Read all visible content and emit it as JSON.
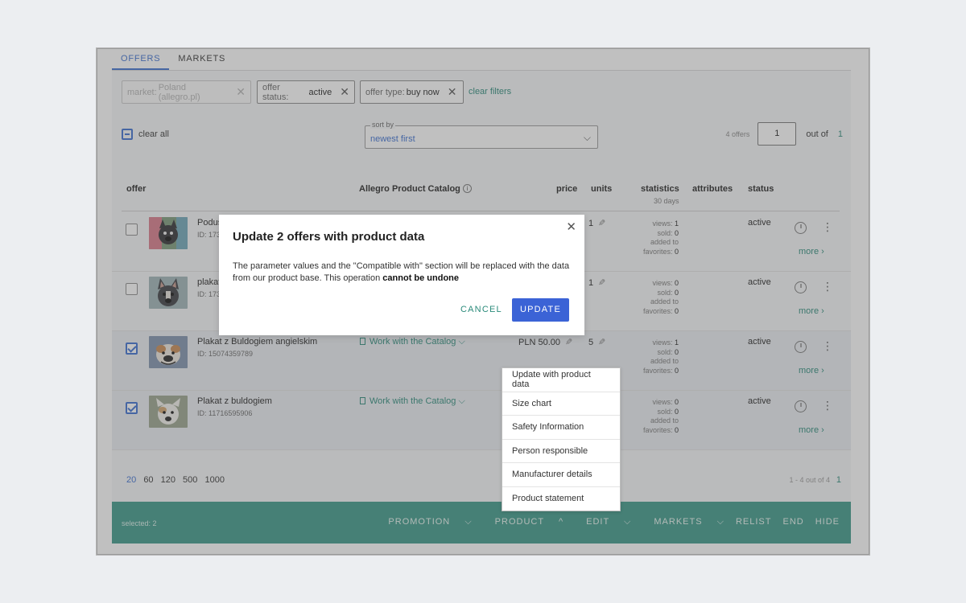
{
  "tabs": [
    "OFFERS",
    "MARKETS"
  ],
  "filters": [
    {
      "key": "market:",
      "value": "Poland (allegro.pl)",
      "disabled": true
    },
    {
      "key": "offer status:",
      "value": "active",
      "disabled": false
    },
    {
      "key": "offer type:",
      "value": "buy now",
      "disabled": false
    }
  ],
  "clear_filters": "clear filters",
  "clear_all": "clear all",
  "sort": {
    "label": "sort by",
    "value": "newest first"
  },
  "pagination_top": {
    "count": "4 offers",
    "page": "1",
    "out_of": "out of",
    "total": "1"
  },
  "columns": {
    "offer": "offer",
    "catalog": "Allegro Product Catalog",
    "price": "price",
    "units": "units",
    "statistics": "statistics",
    "statistics_sub": "30 days",
    "attributes": "attributes",
    "status": "status"
  },
  "rows": [
    {
      "title": "Podus",
      "id": "ID: 173",
      "catalog": "",
      "price": "",
      "units": "1",
      "views": "1",
      "sold": "0",
      "favorites": "0",
      "status": "active",
      "checked": false,
      "more": "more"
    },
    {
      "title": "plakat",
      "id": "ID: 173",
      "catalog": "",
      "price": "",
      "units": "1",
      "views": "0",
      "sold": "0",
      "favorites": "0",
      "status": "active",
      "checked": false,
      "more": "more"
    },
    {
      "title": "Plakat z Buldogiem angielskim",
      "id": "ID: 15074359789",
      "catalog": "Work with the Catalog",
      "price": "PLN 50.00",
      "units": "5",
      "views": "1",
      "sold": "0",
      "favorites": "0",
      "status": "active",
      "checked": true,
      "more": "more"
    },
    {
      "title": "Plakat z buldogiem",
      "id": "ID: 11716595906",
      "catalog": "Work with the Catalog",
      "price": "",
      "units": "",
      "views": "0",
      "sold": "0",
      "favorites": "0",
      "status": "active",
      "checked": true,
      "more": "more"
    }
  ],
  "stat_labels": {
    "views": "views:",
    "sold": "sold:",
    "added_to": "added to",
    "favorites": "favorites:"
  },
  "page_sizes": [
    "20",
    "60",
    "120",
    "500",
    "1000"
  ],
  "range": "1 - 4 out of 4",
  "range_page": "1",
  "bottom_bar": {
    "selected": "selected: 2",
    "actions": [
      "PROMOTION",
      "PRODUCT",
      "EDIT",
      "MARKETS",
      "RELIST",
      "END",
      "HIDE"
    ]
  },
  "product_menu": [
    "Update with product data",
    "Size chart",
    "Safety Information",
    "Person responsible",
    "Manufacturer details",
    "Product statement"
  ],
  "dialog": {
    "title": "Update 2 offers with product data",
    "body": "The parameter values and the \"Compatible with\" section will be replaced with the data from our product base. This operation ",
    "body_bold": "cannot be undone",
    "cancel": "CANCEL",
    "update": "UPDATE"
  },
  "icons": {
    "close": "close-icon",
    "chevron": "chevron-down-icon",
    "pencil": "pencil-icon",
    "info": "info-icon"
  },
  "colors": {
    "accent": "#3b6fd1",
    "teal": "#2a8a7a",
    "bar": "#3a9888",
    "primary_button": "#3b63d6"
  }
}
